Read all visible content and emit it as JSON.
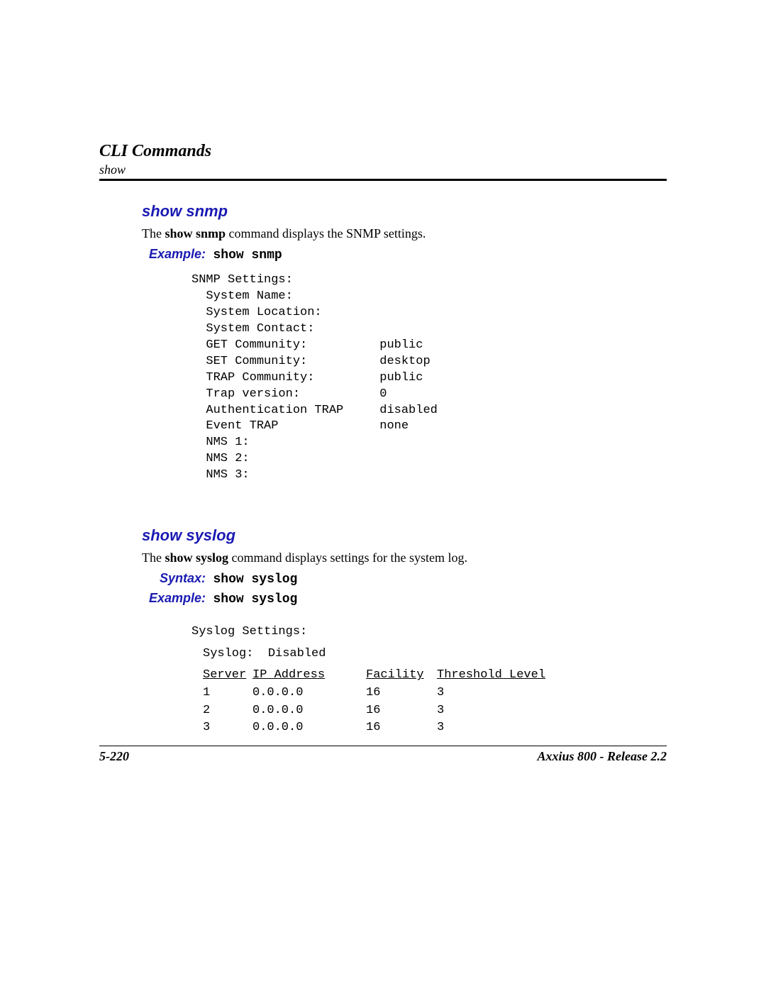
{
  "header": {
    "title": "CLI Commands",
    "subtitle": "show"
  },
  "section1": {
    "heading": "show snmp",
    "desc_pre": "The ",
    "desc_cmd": "show snmp",
    "desc_post": " command displays the SNMP settings.",
    "example_label": "Example:",
    "example_cmd": "show snmp",
    "output": "SNMP Settings:\n  System Name:\n  System Location:\n  System Contact:\n  GET Community:          public\n  SET Community:          desktop\n  TRAP Community:         public\n  Trap version:           0\n  Authentication TRAP     disabled\n  Event TRAP              none\n  NMS 1:\n  NMS 2:\n  NMS 3:"
  },
  "section2": {
    "heading": "show syslog",
    "desc_pre": "The ",
    "desc_cmd": "show syslog",
    "desc_post": " command displays settings for the system log.",
    "syntax_label": "Syntax:",
    "syntax_cmd": "show syslog",
    "example_label": "Example:",
    "example_cmd": "show syslog",
    "out_title": "Syslog Settings:",
    "out_status_lbl": "Syslog:",
    "out_status_val": "Disabled",
    "headers": {
      "server": "Server",
      "ip": "IP Address",
      "facility": "Facility",
      "threshold": "Threshold Level"
    },
    "rows": [
      {
        "server": "1",
        "ip": "0.0.0.0",
        "facility": "16",
        "threshold": "3"
      },
      {
        "server": "2",
        "ip": "0.0.0.0",
        "facility": "16",
        "threshold": "3"
      },
      {
        "server": "3",
        "ip": "0.0.0.0",
        "facility": "16",
        "threshold": "3"
      }
    ]
  },
  "footer": {
    "left": "5-220",
    "right": "Axxius 800 - Release 2.2"
  }
}
